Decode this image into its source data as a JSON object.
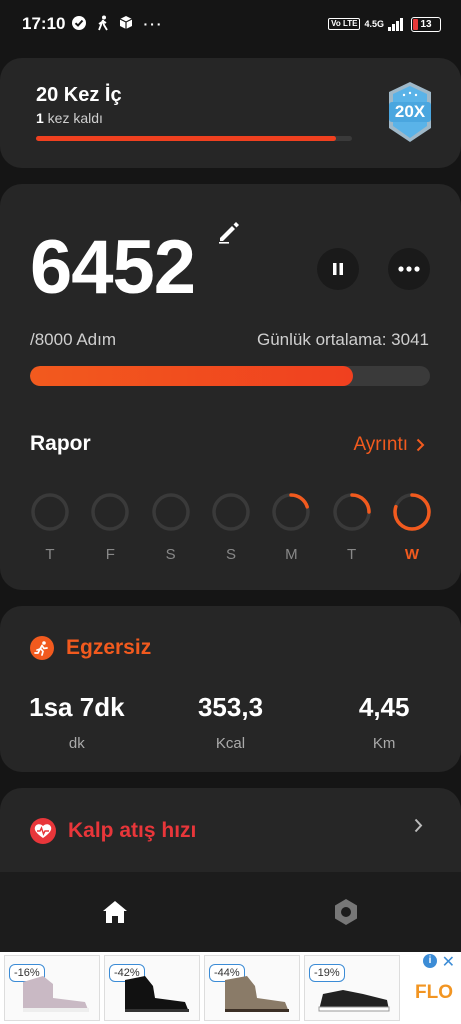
{
  "status_bar": {
    "time": "17:10",
    "network": "4.5G",
    "volte": "Vo LTE",
    "battery": "13"
  },
  "challenge": {
    "title": "20 Kez İç",
    "remaining_count": "1",
    "remaining_text": " kez kaldı",
    "progress": 0.95,
    "badge_text": "20X"
  },
  "steps": {
    "count": "6452",
    "goal": "/8000 Adım",
    "daily_average": "Günlük ortalama: 3041",
    "progress": 0.8065
  },
  "report": {
    "title": "Rapor",
    "detail_link": "Ayrıntı",
    "days": [
      {
        "label": "T",
        "progress": 0
      },
      {
        "label": "F",
        "progress": 0
      },
      {
        "label": "S",
        "progress": 0
      },
      {
        "label": "S",
        "progress": 0
      },
      {
        "label": "M",
        "progress": 0.2
      },
      {
        "label": "T",
        "progress": 0.25
      },
      {
        "label": "W",
        "progress": 0.8,
        "active": true
      }
    ]
  },
  "exercise": {
    "title": "Egzersiz",
    "stats": [
      {
        "value": "1sa 7dk",
        "unit": "dk"
      },
      {
        "value": "353,3",
        "unit": "Kcal"
      },
      {
        "value": "4,45",
        "unit": "Km"
      }
    ]
  },
  "heart_rate": {
    "title": "Kalp atış hızı"
  },
  "ad": {
    "items": [
      {
        "discount": "-16%"
      },
      {
        "discount": "-42%"
      },
      {
        "discount": "-44%"
      },
      {
        "discount": "-19%"
      }
    ],
    "brand": "FLO"
  },
  "colors": {
    "accent": "#f25a1e",
    "heart": "#e8363a",
    "card": "#262626",
    "background": "#151515"
  }
}
